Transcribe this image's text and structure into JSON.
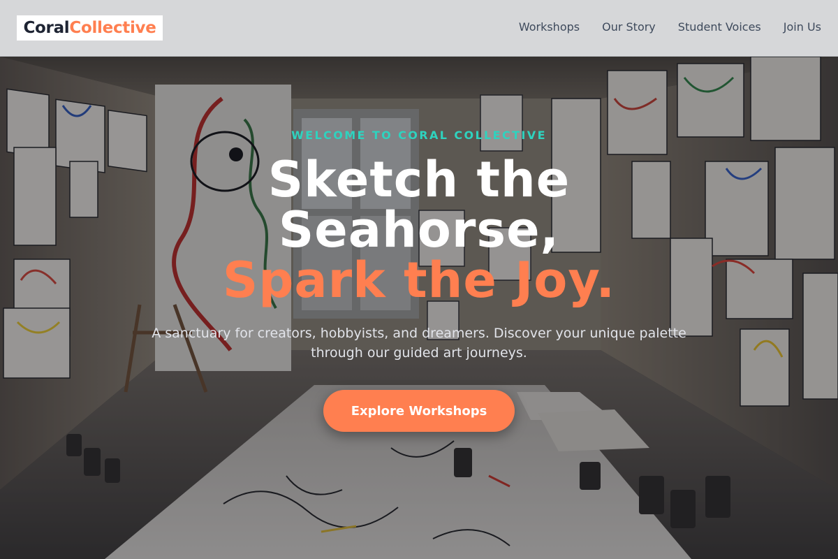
{
  "brand": {
    "part1": "Coral",
    "part2": "Collective"
  },
  "nav": {
    "items": [
      "Workshops",
      "Our Story",
      "Student Voices",
      "Join Us"
    ]
  },
  "hero": {
    "eyebrow": "WELCOME TO CORAL COLLECTIVE",
    "headline_line1": "Sketch the",
    "headline_line2": "Seahorse,",
    "headline_accent": "Spark the Joy.",
    "subtitle": "A sanctuary for creators, hobbyists, and dreamers. Discover your unique palette through our guided art journeys.",
    "cta_label": "Explore Workshops"
  },
  "colors": {
    "accent": "#ff7f50",
    "eyebrow": "#2ed3bf",
    "header_bg": "#d6d7d9",
    "brand_dark": "#1e2433",
    "nav_text": "#3e4a5c"
  },
  "background_image": "artist-studio-photo"
}
